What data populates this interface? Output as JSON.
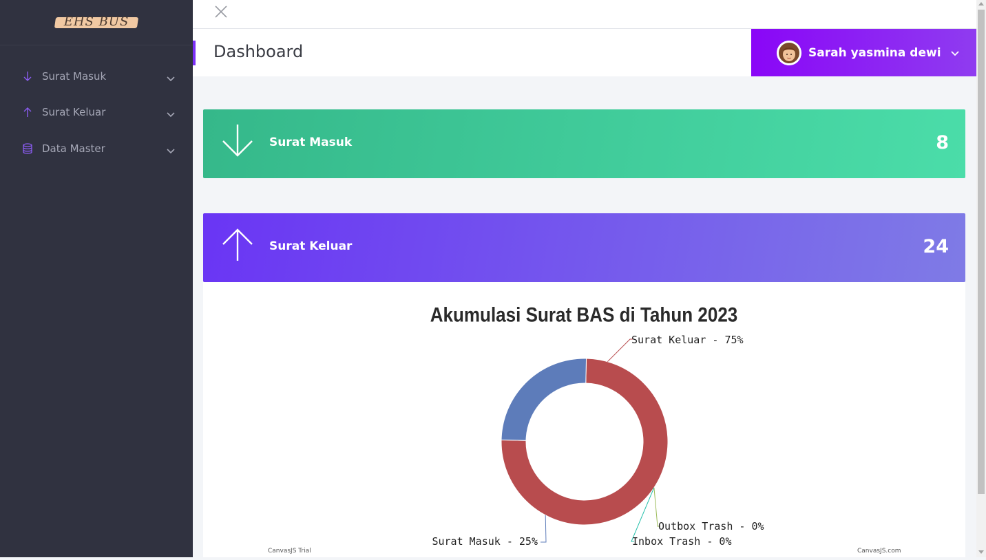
{
  "brand": {
    "logo_text": "EHS BUS",
    "colors": {
      "sidebar": "#303240",
      "accent": "#7b2ff7",
      "green": "#3dc494",
      "purple": "#6e4bf0"
    }
  },
  "sidebar": {
    "items": [
      {
        "label": "Surat Masuk",
        "icon": "arrow-down-icon"
      },
      {
        "label": "Surat Keluar",
        "icon": "arrow-up-icon"
      },
      {
        "label": "Data Master",
        "icon": "database-icon"
      }
    ]
  },
  "header": {
    "title": "Dashboard",
    "user_name": "Sarah yasmina dewi"
  },
  "cards": [
    {
      "label": "Surat Masuk",
      "count": "8",
      "icon": "arrow-down-icon"
    },
    {
      "label": "Surat Keluar",
      "count": "24",
      "icon": "arrow-up-icon"
    }
  ],
  "chart_data": {
    "type": "pie",
    "variant": "doughnut",
    "title": "Akumulasi Surat BAS di Tahun 2023",
    "slices": [
      {
        "label": "Surat Keluar - 75%",
        "value": 75,
        "color": "#b84c4e"
      },
      {
        "label": "Outbox Trash - 0%",
        "value": 0,
        "color": "#9bbb59"
      },
      {
        "label": "Inbox Trash - 0%",
        "value": 0,
        "color": "#23bfaa"
      },
      {
        "label": "Surat Masuk - 25%",
        "value": 25,
        "color": "#5d7cba"
      }
    ],
    "watermark_left": "CanvasJS Trial",
    "watermark_right": "CanvasJS.com"
  }
}
